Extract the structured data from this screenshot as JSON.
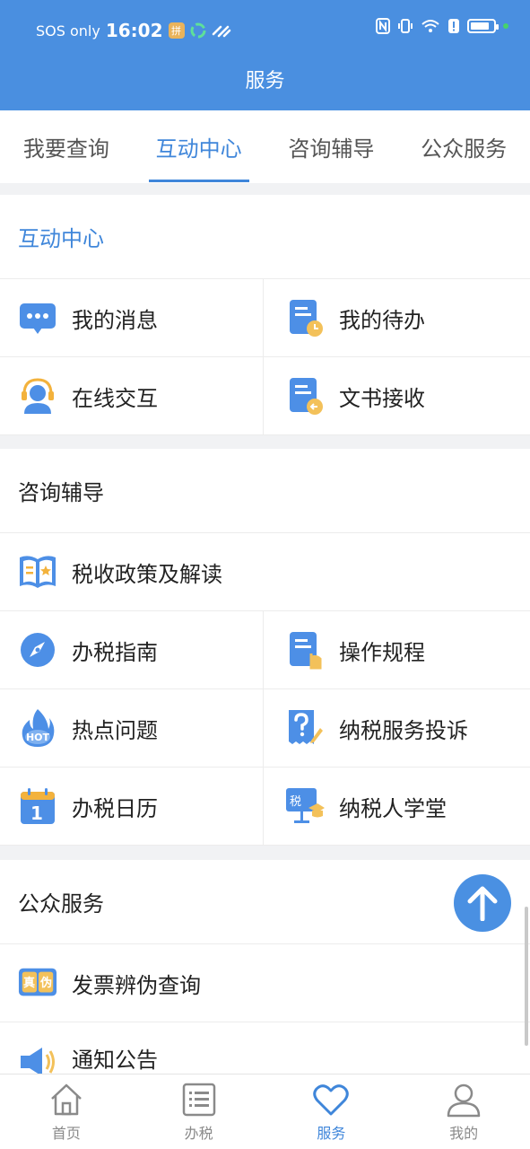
{
  "status_bar": {
    "carrier": "SOS only",
    "time": "16:02",
    "badge": "拼",
    "icons": [
      "nfc-icon",
      "vibrate-icon",
      "wifi-icon",
      "alert-icon",
      "battery-icon"
    ]
  },
  "header": {
    "title": "服务"
  },
  "tabs": [
    {
      "label": "我要查询",
      "active": false
    },
    {
      "label": "互动中心",
      "active": true
    },
    {
      "label": "咨询辅导",
      "active": false
    },
    {
      "label": "公众服务",
      "active": false
    }
  ],
  "interaction": {
    "title": "互动中心",
    "items": [
      {
        "label": "我的消息",
        "icon": "message-icon"
      },
      {
        "label": "我的待办",
        "icon": "todo-doc-icon"
      },
      {
        "label": "在线交互",
        "icon": "headset-agent-icon"
      },
      {
        "label": "文书接收",
        "icon": "receive-doc-icon"
      }
    ]
  },
  "consult": {
    "title": "咨询辅导",
    "items": [
      {
        "label": "税收政策及解读",
        "icon": "policy-book-icon"
      },
      {
        "label": "办税指南",
        "icon": "compass-icon"
      },
      {
        "label": "操作规程",
        "icon": "procedure-doc-icon"
      },
      {
        "label": "热点问题",
        "icon": "hot-flame-icon"
      },
      {
        "label": "纳税服务投诉",
        "icon": "complaint-question-icon"
      },
      {
        "label": "办税日历",
        "icon": "calendar-icon"
      },
      {
        "label": "纳税人学堂",
        "icon": "classroom-icon"
      }
    ]
  },
  "public": {
    "title": "公众服务",
    "items": [
      {
        "label": "发票辨伪查询",
        "icon": "invoice-verify-icon"
      },
      {
        "label": "通知公告",
        "icon": "speaker-icon"
      }
    ]
  },
  "icon_text": {
    "hot": "HOT",
    "calendar_day": "1",
    "tax": "税",
    "real": "真",
    "fake": "伪"
  },
  "bottom_nav": [
    {
      "label": "首页",
      "icon": "home-icon",
      "active": false
    },
    {
      "label": "办税",
      "icon": "list-icon",
      "active": false
    },
    {
      "label": "服务",
      "icon": "heart-icon",
      "active": true
    },
    {
      "label": "我的",
      "icon": "person-icon",
      "active": false
    }
  ],
  "colors": {
    "brand": "#4a8fe0",
    "accent": "#3f86da",
    "divider": "#f1f2f4"
  }
}
